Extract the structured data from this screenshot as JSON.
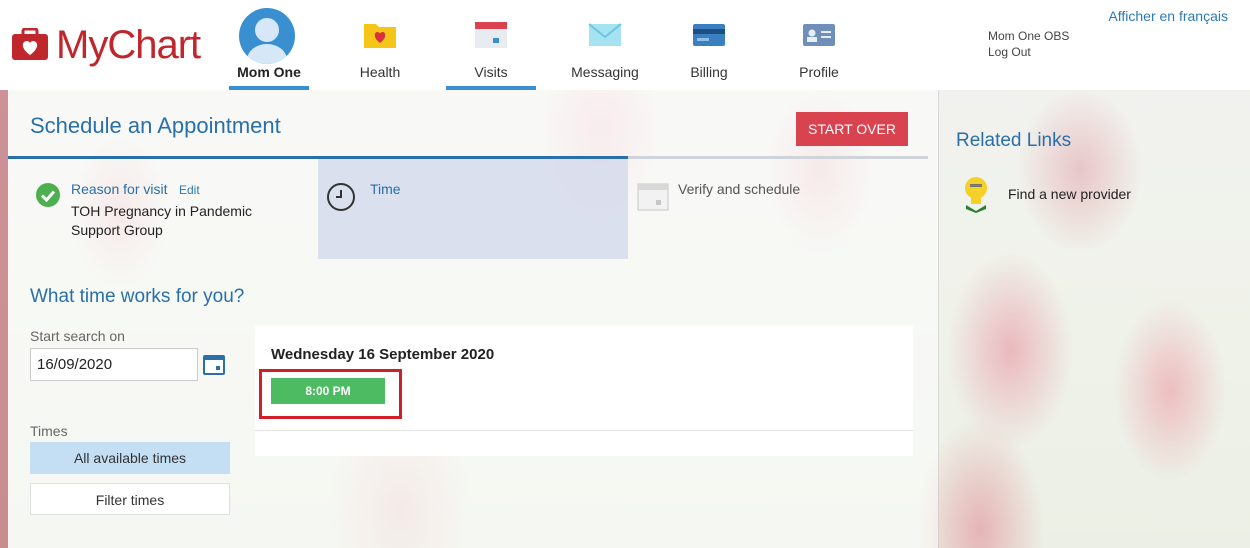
{
  "header": {
    "logo_text": "MyChart",
    "tabs": [
      {
        "label": "Mom One"
      },
      {
        "label": "Health"
      },
      {
        "label": "Visits"
      },
      {
        "label": "Messaging"
      },
      {
        "label": "Billing"
      },
      {
        "label": "Profile"
      }
    ],
    "user_name": "Mom One OBS",
    "logout": "Log Out",
    "language_link": "Afficher en français"
  },
  "page": {
    "title": "Schedule an Appointment",
    "start_over": "START OVER"
  },
  "steps": [
    {
      "title": "Reason for visit",
      "edit": "Edit",
      "description": "TOH Pregnancy in Pandemic Support Group"
    },
    {
      "title": "Time"
    },
    {
      "title": "Verify and schedule"
    }
  ],
  "search": {
    "heading": "What time works for you?",
    "start_label": "Start search on",
    "start_date": "16/09/2020",
    "times_label": "Times",
    "all_times": "All available times",
    "filter_times": "Filter times"
  },
  "slots": {
    "date": "Wednesday 16 September 2020",
    "times": [
      "8:00 PM"
    ]
  },
  "related": {
    "title": "Related Links",
    "links": [
      "Find a new provider"
    ]
  },
  "colors": {
    "brand_red": "#c0272d",
    "accent_blue": "#2a6fa8",
    "start_over": "#d9434f",
    "slot_green": "#4dbb62",
    "highlight": "#d01f26"
  }
}
